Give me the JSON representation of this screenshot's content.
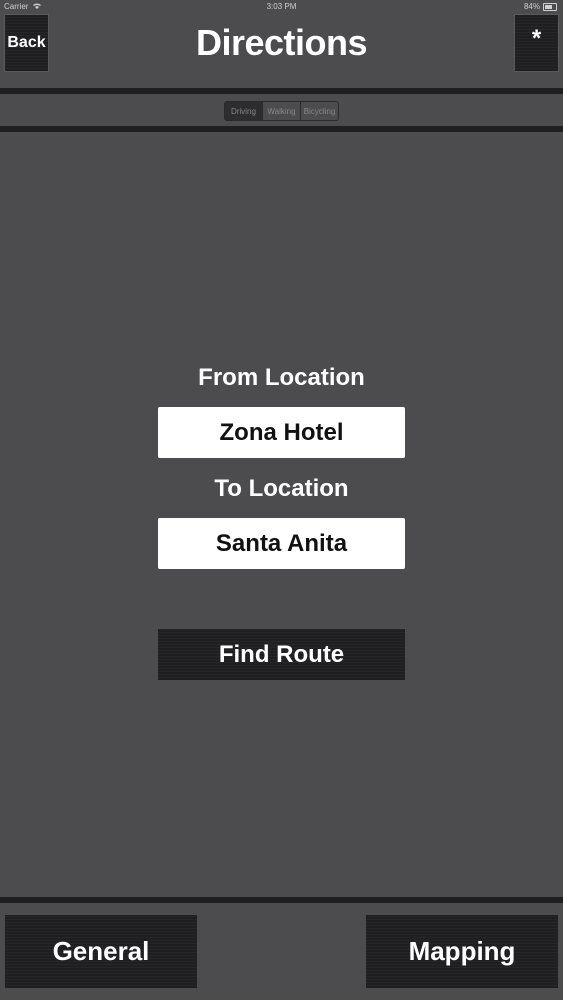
{
  "status_bar": {
    "carrier": "Carrier",
    "time": "3:03 PM",
    "battery": "84%"
  },
  "header": {
    "back_label": "Back",
    "title": "Directions",
    "star_label": "*"
  },
  "transport_modes": {
    "options": [
      "Driving",
      "Walking",
      "Bicycling"
    ],
    "selected": "Driving"
  },
  "form": {
    "from_label": "From Location",
    "from_value": "Zona Hotel",
    "to_label": "To Location",
    "to_value": "Santa Anita",
    "find_route_label": "Find Route"
  },
  "bottom_nav": {
    "general_label": "General",
    "mapping_label": "Mapping"
  },
  "colors": {
    "background": "#4c4b4d",
    "button_dark": "#1f1e20",
    "field_bg": "#ffffff"
  }
}
